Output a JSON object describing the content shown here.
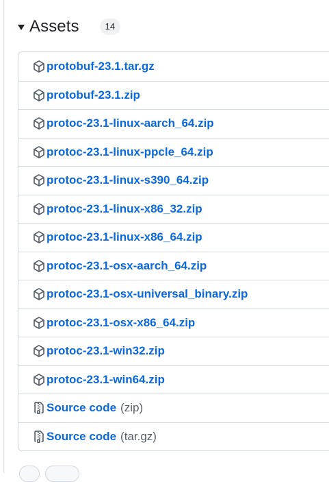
{
  "assets": {
    "title": "Assets",
    "count": "14",
    "items": [
      {
        "icon": "package-icon",
        "name": "protobuf-23.1.tar.gz"
      },
      {
        "icon": "package-icon",
        "name": "protobuf-23.1.zip"
      },
      {
        "icon": "package-icon",
        "name": "protoc-23.1-linux-aarch_64.zip"
      },
      {
        "icon": "package-icon",
        "name": "protoc-23.1-linux-ppcle_64.zip"
      },
      {
        "icon": "package-icon",
        "name": "protoc-23.1-linux-s390_64.zip"
      },
      {
        "icon": "package-icon",
        "name": "protoc-23.1-linux-x86_32.zip"
      },
      {
        "icon": "package-icon",
        "name": "protoc-23.1-linux-x86_64.zip"
      },
      {
        "icon": "package-icon",
        "name": "protoc-23.1-osx-aarch_64.zip"
      },
      {
        "icon": "package-icon",
        "name": "protoc-23.1-osx-universal_binary.zip"
      },
      {
        "icon": "package-icon",
        "name": "protoc-23.1-osx-x86_64.zip"
      },
      {
        "icon": "package-icon",
        "name": "protoc-23.1-win32.zip"
      },
      {
        "icon": "package-icon",
        "name": "protoc-23.1-win64.zip"
      },
      {
        "icon": "file-zip-icon",
        "name": "Source code",
        "suffix": "(zip)"
      },
      {
        "icon": "file-zip-icon",
        "name": "Source code",
        "suffix": "(tar.gz)"
      }
    ]
  },
  "colors": {
    "link": "#0969da",
    "border": "#d0d7de",
    "muted": "#57606a"
  }
}
